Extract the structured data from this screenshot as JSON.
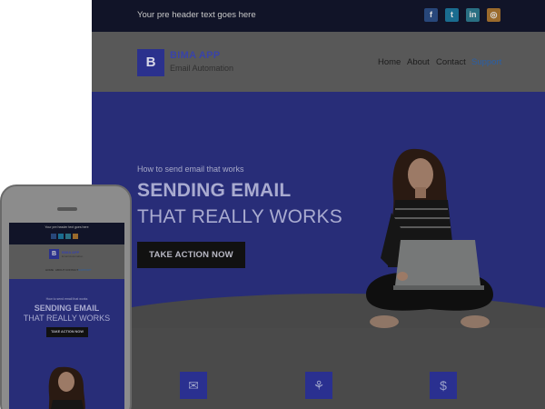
{
  "desktop": {
    "preheader": {
      "text": "Your pre header text goes here"
    },
    "social": [
      {
        "icon": "facebook-icon",
        "glyph": "f"
      },
      {
        "icon": "twitter-icon",
        "glyph": "t"
      },
      {
        "icon": "linkedin-icon",
        "glyph": "in"
      },
      {
        "icon": "instagram-icon",
        "glyph": "◎"
      }
    ],
    "brand": {
      "logo_letter": "B",
      "name": "BIMA APP",
      "tagline": "Email Automation"
    },
    "nav": {
      "home": "Home",
      "about": "About",
      "contact": "Contact",
      "support": "Support"
    },
    "hero": {
      "kicker": "How to send email that works",
      "headline_1": "SENDING EMAIL",
      "headline_2": "THAT REALLY WORKS",
      "cta": "TAKE ACTION NOW"
    },
    "features": [
      {
        "icon": "envelope-icon",
        "glyph": "✉"
      },
      {
        "icon": "users-icon",
        "glyph": "⚘"
      },
      {
        "icon": "dollar-icon",
        "glyph": "$"
      }
    ]
  },
  "mobile": {
    "preheader": "Your pre header text goes here",
    "brand": {
      "logo_letter": "B",
      "name": "BIMA APP",
      "tagline": "Email Automation"
    },
    "nav": {
      "home": "HOME",
      "about": "ABOUT",
      "contact": "CONTACT",
      "support": "SUPPORT"
    },
    "hero": {
      "kicker": "How to send email that works",
      "headline_1": "SENDING EMAIL",
      "headline_2": "THAT REALLY WORKS",
      "cta": "TAKE ACTION NOW"
    }
  },
  "colors": {
    "preheader_bg": "#111428",
    "brand_blue": "#2b318d",
    "hero_bg": "#282d78",
    "button_bg": "#111111",
    "link_support": "#2a5fa6"
  }
}
